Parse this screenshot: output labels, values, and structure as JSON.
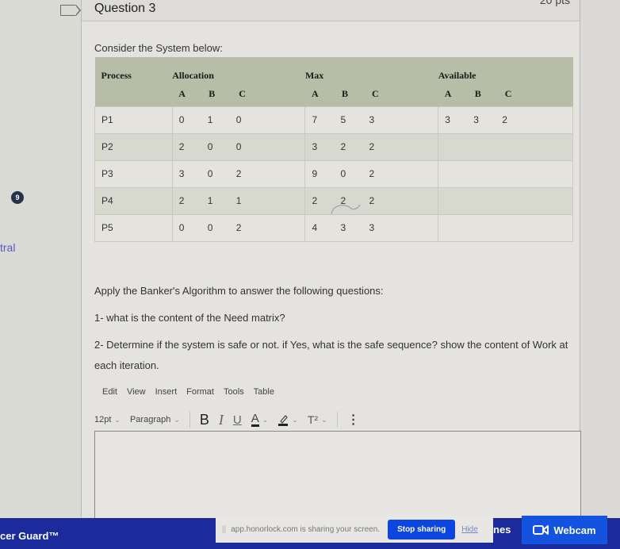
{
  "left_rail": {
    "badge_count": "9",
    "partial_link": "tral"
  },
  "question": {
    "title": "Question 3",
    "points": "20 pts",
    "intro": "Consider the System below:",
    "table": {
      "headers": {
        "process": "Process",
        "allocation": "Allocation",
        "max": "Max",
        "available": "Available",
        "resources": [
          "A",
          "B",
          "C"
        ]
      },
      "rows": [
        {
          "process": "P1",
          "allocation": [
            "0",
            "1",
            "0"
          ],
          "max": [
            "7",
            "5",
            "3"
          ],
          "available": [
            "3",
            "3",
            "2"
          ]
        },
        {
          "process": "P2",
          "allocation": [
            "2",
            "0",
            "0"
          ],
          "max": [
            "3",
            "2",
            "2"
          ],
          "available": [
            "",
            "",
            ""
          ]
        },
        {
          "process": "P3",
          "allocation": [
            "3",
            "0",
            "2"
          ],
          "max": [
            "9",
            "0",
            "2"
          ],
          "available": [
            "",
            "",
            ""
          ]
        },
        {
          "process": "P4",
          "allocation": [
            "2",
            "1",
            "1"
          ],
          "max": [
            "2",
            "2",
            "2"
          ],
          "available": [
            "",
            "",
            ""
          ]
        },
        {
          "process": "P5",
          "allocation": [
            "0",
            "0",
            "2"
          ],
          "max": [
            "4",
            "3",
            "3"
          ],
          "available": [
            "",
            "",
            ""
          ]
        }
      ]
    },
    "prompt": "Apply the Banker's Algorithm to answer the following questions:",
    "q1": "1- what is the content of the Need matrix?",
    "q2": "2- Determine if the system is safe or not. if Yes, what is the safe sequence? show the content of Work at each iteration."
  },
  "editor": {
    "menu": [
      "Edit",
      "View",
      "Insert",
      "Format",
      "Tools",
      "Table"
    ],
    "font_size": "12pt",
    "block_format": "Paragraph",
    "bold": "B",
    "italic": "I",
    "underline": "U",
    "text_color": "A",
    "superscript": "T²",
    "more": "⋮",
    "content": ""
  },
  "taskbar": {
    "guard_label": "cer Guard™",
    "share_message": "app.honorlock.com is sharing your screen.",
    "stop_sharing": "Stop sharing",
    "hide": "Hide",
    "partial_label": "nes",
    "webcam": "Webcam"
  },
  "colors": {
    "table_header": "#b7bda6",
    "taskbar": "#1b2b9c",
    "button_blue": "#0d45e0"
  }
}
